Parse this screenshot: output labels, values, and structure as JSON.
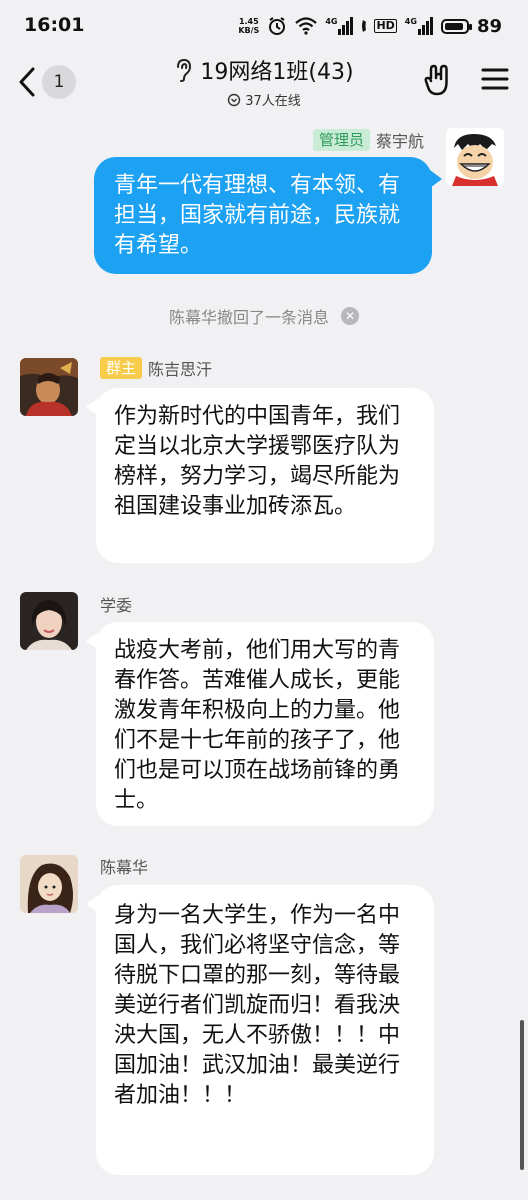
{
  "status_bar": {
    "time": "16:01",
    "speed_value": "1.45",
    "speed_unit": "KB/S",
    "signal1_label": "4G",
    "hd_label": "HD",
    "signal2_label": "4G",
    "battery": "89",
    "battery_level": 0.89
  },
  "header": {
    "unread_count": "1",
    "title": "19网络1班(43)",
    "online": "37人在线"
  },
  "messages": [
    {
      "side": "right",
      "tag": "管理员",
      "sender": "蔡宇航",
      "text": "青年一代有理想、有本领、有担当，国家就有前途，民族就有希望。"
    },
    {
      "side": "left",
      "tag": "群主",
      "sender": "陈吉思汗",
      "text": "作为新时代的中国青年，我们定当以北京大学援鄂医疗队为榜样，努力学习，竭尽所能为祖国建设事业加砖添瓦。"
    },
    {
      "side": "left",
      "sender": "学委",
      "text": "战疫大考前，他们用大写的青春作答。苦难催人成长，更能激发青年积极向上的力量。他们不是十七年前的孩子了，他们也是可以顶在战场前锋的勇士。"
    },
    {
      "side": "left",
      "sender": "陈幕华",
      "text": "身为一名大学生，作为一名中国人，我们必将坚守信念，等待脱下口罩的那一刻，等待最美逆行者们凯旋而归！看我泱泱大国，无人不骄傲！！！中国加油！武汉加油！最美逆行者加油！！！"
    }
  ],
  "recall_notice": "陈幕华撤回了一条消息",
  "colors": {
    "self_bubble": "#1da1f2",
    "other_bubble": "#ffffff",
    "background": "#f1f1f3",
    "admin_tag": "#2f9a5a",
    "owner_tag": "#f6cc4a"
  },
  "icons": [
    "back-icon",
    "ear-icon",
    "online-icon",
    "rock-hand-icon",
    "menu-icon",
    "recall-close-icon"
  ]
}
